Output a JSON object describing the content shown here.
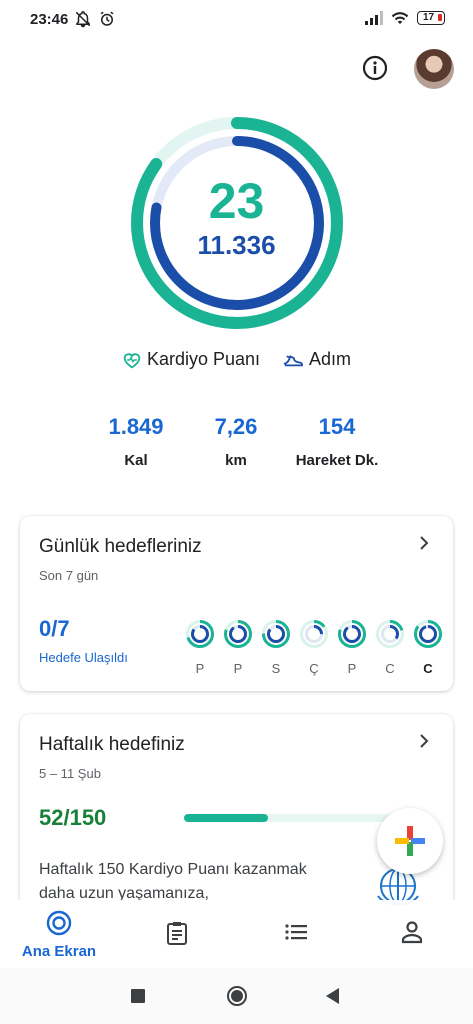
{
  "status_bar": {
    "time": "23:46",
    "battery": "17"
  },
  "top_actions": {
    "info_icon": "info-icon",
    "avatar_icon": "avatar"
  },
  "summary": {
    "cardio_points": "23",
    "steps": "11.336",
    "cardio_progress": 0.85,
    "steps_progress": 0.78,
    "cardio_color": "#1ab394",
    "steps_color": "#1b4ea8",
    "legend": [
      {
        "label": "Kardiyo Puanı",
        "icon": "heart-icon"
      },
      {
        "label": "Adım",
        "icon": "shoe-icon"
      }
    ]
  },
  "stats": [
    {
      "value": "1.849",
      "label": "Kal"
    },
    {
      "value": "7,26",
      "label": "km"
    },
    {
      "value": "154",
      "label": "Hareket Dk."
    }
  ],
  "daily_card": {
    "title": "Günlük hedefleriniz",
    "subtitle": "Son 7 gün",
    "count": "0/7",
    "count_label": "Hedefe Ulaşıldı",
    "days": [
      {
        "letter": "P",
        "cardio": 0.7,
        "steps": 0.85
      },
      {
        "letter": "P",
        "cardio": 0.8,
        "steps": 0.9
      },
      {
        "letter": "S",
        "cardio": 0.75,
        "steps": 0.85
      },
      {
        "letter": "Ç",
        "cardio": 0.15,
        "steps": 0.25
      },
      {
        "letter": "P",
        "cardio": 0.8,
        "steps": 0.9
      },
      {
        "letter": "C",
        "cardio": 0.2,
        "steps": 0.35
      },
      {
        "letter": "C",
        "cardio": 0.85,
        "steps": 0.95,
        "today": true
      }
    ]
  },
  "weekly_card": {
    "title": "Haftalık hedefiniz",
    "subtitle": "5 – 11 Şub",
    "count": "52/150",
    "progress": 0.35,
    "description": "Haftalık 150 Kardiyo Puanı kazanmak daha uzun yaşamanıza,"
  },
  "fab": {
    "icon": "plus-icon"
  },
  "bottom_nav": {
    "home_label": "Ana Ekran"
  }
}
